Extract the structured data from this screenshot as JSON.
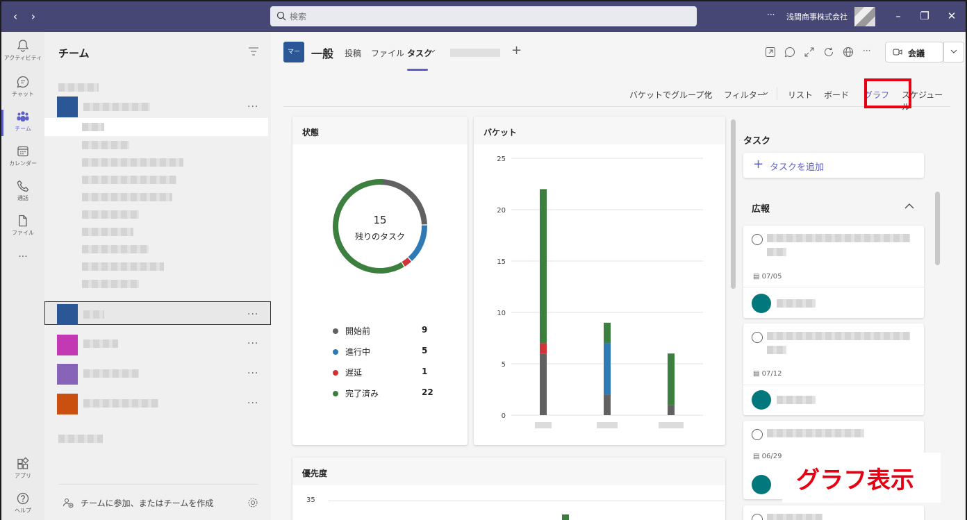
{
  "search": {
    "placeholder": "検索"
  },
  "titlebar": {
    "org_name": "浅間商事株式会社",
    "more": "···"
  },
  "rail": [
    {
      "label": "アクティビティ"
    },
    {
      "label": "チャット"
    },
    {
      "label": "チーム"
    },
    {
      "label": "カレンダー"
    },
    {
      "label": "通話"
    },
    {
      "label": "ファイル"
    },
    {
      "label": "アプリ"
    },
    {
      "label": "ヘルプ"
    }
  ],
  "rail_more": "···",
  "teams": {
    "title": "チーム",
    "join_label": "チームに参加、またはチームを作成",
    "more": "···"
  },
  "channel": {
    "badge": "マー",
    "name": "一般",
    "tabs": [
      "投稿",
      "ファイル",
      "タスク"
    ],
    "add_tab": "+"
  },
  "header": {
    "meeting_label": "会議",
    "more": "···"
  },
  "planner_toolbar": [
    "バケットでグループ化",
    "フィルター",
    "リスト",
    "ボード",
    "グラフ",
    "スケジュール"
  ],
  "status_card": {
    "title": "状態",
    "remaining_count": "15",
    "remaining_label": "残りのタスク",
    "legend": [
      {
        "label": "開始前",
        "value": 9,
        "color": "#616161"
      },
      {
        "label": "進行中",
        "value": 5,
        "color": "#2f7ab5"
      },
      {
        "label": "遅延",
        "value": 1,
        "color": "#d13438"
      },
      {
        "label": "完了済み",
        "value": 22,
        "color": "#3d7f3e"
      }
    ]
  },
  "bucket_card": {
    "title": "バケット"
  },
  "priority_card": {
    "title": "優先度",
    "y_top": "35"
  },
  "chart_data": [
    {
      "type": "pie",
      "title": "状態",
      "categories": [
        "開始前",
        "進行中",
        "遅延",
        "完了済み"
      ],
      "values": [
        9,
        5,
        1,
        22
      ]
    },
    {
      "type": "bar",
      "title": "バケット",
      "ylim": [
        0,
        25
      ],
      "yticks": [
        0,
        5,
        10,
        15,
        20,
        25
      ],
      "series": [
        {
          "name": "開始前",
          "values": [
            6,
            2,
            1
          ]
        },
        {
          "name": "進行中",
          "values": [
            0,
            5,
            0
          ]
        },
        {
          "name": "遅延",
          "values": [
            1,
            0,
            0
          ]
        },
        {
          "name": "完了済み",
          "values": [
            15,
            2,
            5
          ]
        }
      ]
    }
  ],
  "task_panel": {
    "title": "タスク",
    "add_label": "タスクを追加",
    "group": "広報",
    "cards": [
      {
        "date": "07/05"
      },
      {
        "date": "07/12"
      },
      {
        "date": "06/29"
      }
    ]
  },
  "annotation": "グラフ表示"
}
